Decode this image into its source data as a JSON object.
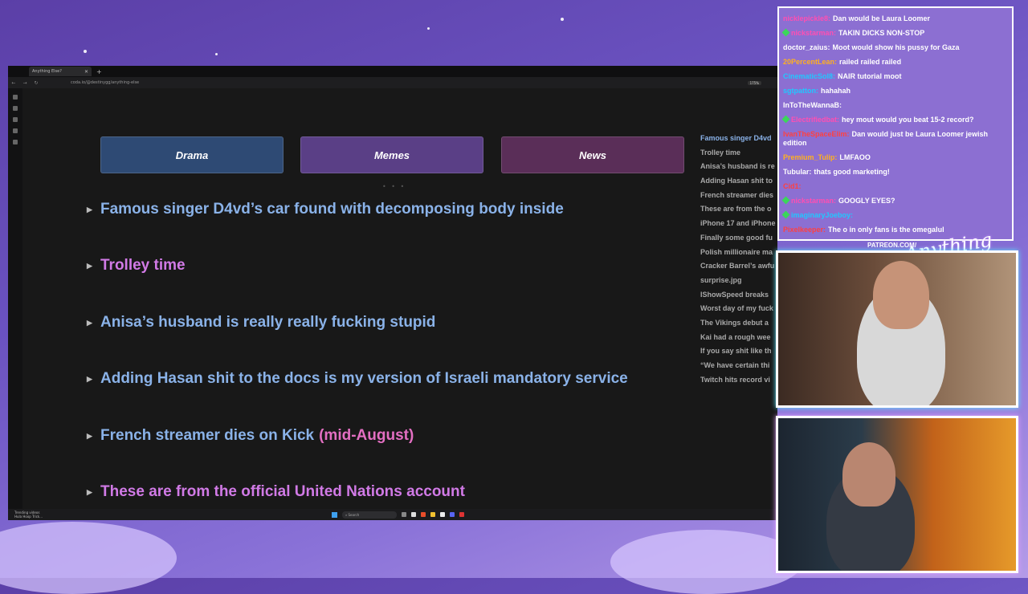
{
  "browser": {
    "tab_title": "Anything Else?",
    "url": "coda.io/@destinygg/anything-else",
    "zoom": "175%"
  },
  "categories": [
    "Drama",
    "Memes",
    "News"
  ],
  "stories": [
    {
      "text": "Famous singer D4vd’s car found with decomposing body inside",
      "color": "blue"
    },
    {
      "text": "Trolley time",
      "color": "pink"
    },
    {
      "text": "Anisa’s husband is really really fucking stupid",
      "color": "blue"
    },
    {
      "text": "Adding Hasan shit to the docs is my version of Israeli mandatory service",
      "color": "blue"
    },
    {
      "text": "French streamer dies on Kick",
      "suffix": "(mid-August)",
      "color": "blue"
    },
    {
      "text": "These are from the official United Nations account",
      "color": "pink"
    }
  ],
  "toc": [
    "Famous singer D4vd",
    "Trolley time",
    "Anisa’s husband is re",
    "Adding Hasan shit to",
    "French streamer dies",
    "These are from the o",
    "iPhone 17 and iPhone",
    "Finally some good fu",
    "Polish millionaire ma",
    "Cracker Barrel’s awfu",
    "surprise.jpg",
    "IShowSpeed breaks",
    "Worst day of my fuck",
    "The Vikings debut a",
    "Kai had a rough wee",
    "If you say shit like th",
    "“We have certain thi",
    "Twitch hits record vi"
  ],
  "taskbar": {
    "widget_line1": "Trending videos",
    "widget_line2": "Hula Hoop Trick...",
    "search_placeholder": "Search"
  },
  "chat": [
    {
      "user": "nicklepickle8:",
      "color": "#ff4fb2",
      "badge": false,
      "text": "Dan would be Laura Loomer"
    },
    {
      "user": "nickstarman:",
      "color": "#ff4fb2",
      "badge": true,
      "text": "TAKIN DICKS NON-STOP"
    },
    {
      "user": "doctor_zaius:",
      "color": "#ffffff",
      "badge": false,
      "text": "Moot would show his pussy for Gaza"
    },
    {
      "user": "20PercentLean:",
      "color": "#ffb020",
      "badge": false,
      "text": "railed railed railed"
    },
    {
      "user": "CinematicSol8:",
      "color": "#20c8ff",
      "badge": false,
      "text": "NAIR tutorial moot"
    },
    {
      "user": "sgtpatton:",
      "color": "#20c8ff",
      "badge": false,
      "text": "hahahah"
    },
    {
      "user": "InToTheWannaB:",
      "color": "#ffffff",
      "badge": false,
      "text": ""
    },
    {
      "user": "Electrifiedbat:",
      "color": "#ff4fb2",
      "badge": true,
      "text": "hey mout would you beat 15-2 record?"
    },
    {
      "user": "IvanTheSpaceElim:",
      "color": "#ff4040",
      "badge": false,
      "text": "Dan would just be Laura Loomer jewish edition"
    },
    {
      "user": "Premium_Tulip:",
      "color": "#ffb020",
      "badge": false,
      "text": "LMFAOO"
    },
    {
      "user": "Tubular:",
      "color": "#ffffff",
      "badge": false,
      "text": "thats good marketing!"
    },
    {
      "user": "Cid1:",
      "color": "#ff4040",
      "badge": false,
      "text": ""
    },
    {
      "user": "nickstarman:",
      "color": "#ff4fb2",
      "badge": true,
      "text": "GOOGLY EYES?"
    },
    {
      "user": "imaginaryJoeboy:",
      "color": "#20c8ff",
      "badge": true,
      "text": ""
    },
    {
      "user": "Pixelkeeper:",
      "color": "#ff4040",
      "badge": false,
      "text": "The o in only fans is the omegalul"
    }
  ],
  "overlay": {
    "patreon": "PATREON.COM/",
    "logo": "Anything Else?"
  }
}
